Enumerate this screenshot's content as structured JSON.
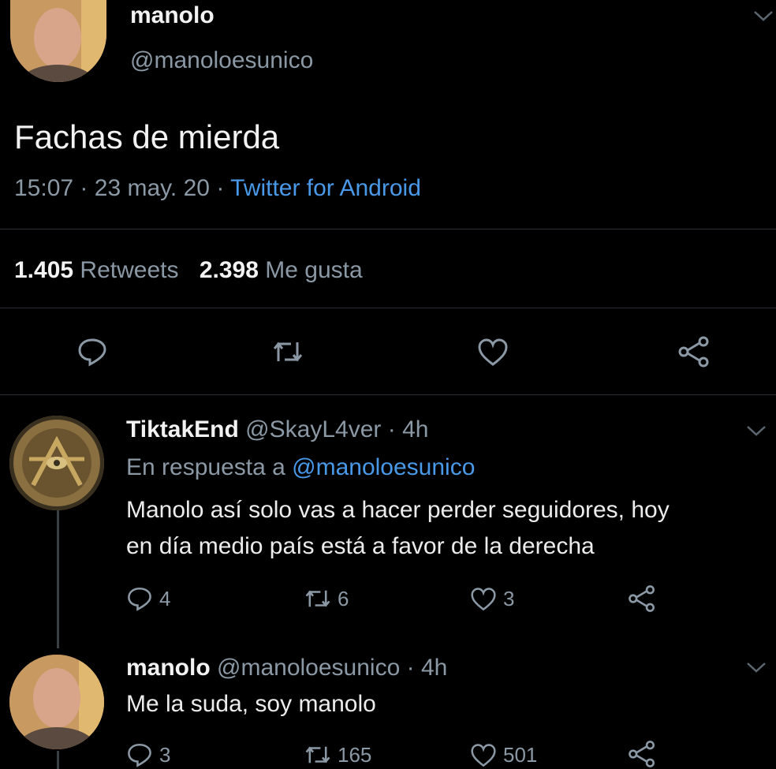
{
  "main_tweet": {
    "display_name": "manolo",
    "handle": "@manoloesunico",
    "text": "Fachas de mierda",
    "time": "15:07",
    "date": "23 may. 20",
    "source": "Twitter for Android",
    "retweets_count": "1.405",
    "retweets_label": "Retweets",
    "likes_count": "2.398",
    "likes_label": "Me gusta"
  },
  "replies": [
    {
      "display_name": "TiktakEnd",
      "handle": "@SkayL4ver",
      "age": "4h",
      "reply_to_label": "En respuesta a",
      "reply_to_handle": "@manoloesunico",
      "text_line1": "Manolo así solo vas a hacer perder seguidores, hoy",
      "text_line2": "en día medio país está a favor de la derecha",
      "reply_count": "4",
      "retweet_count": "6",
      "like_count": "3"
    },
    {
      "display_name": "manolo",
      "handle": "@manoloesunico",
      "age": "4h",
      "text_line1": "Me la suda, soy manolo",
      "reply_count": "3",
      "retweet_count": "165",
      "like_count": "501"
    }
  ],
  "separator": "·",
  "icons": [
    "reply-icon",
    "retweet-icon",
    "like-icon",
    "share-icon",
    "chevron-down-icon"
  ],
  "colors": {
    "background": "#000000",
    "text": "#e6e6e6",
    "muted": "#8b98a5",
    "link": "#4a99e9",
    "divider": "#2b2f33"
  }
}
